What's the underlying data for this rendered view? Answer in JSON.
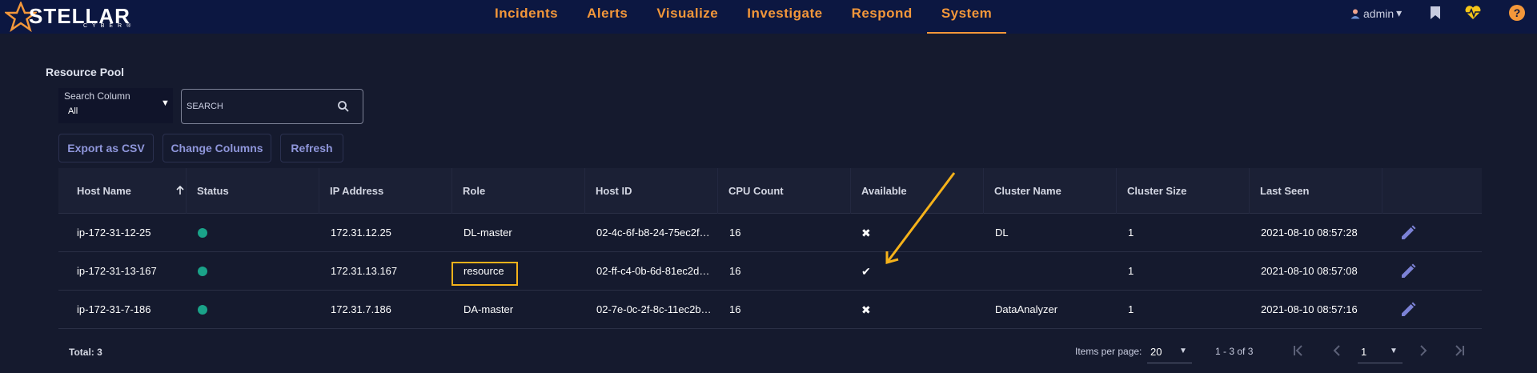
{
  "brand": {
    "name": "STELLAR",
    "sub": "CYBER®"
  },
  "nav": {
    "items": [
      {
        "label": "Incidents"
      },
      {
        "label": "Alerts"
      },
      {
        "label": "Visualize"
      },
      {
        "label": "Investigate"
      },
      {
        "label": "Respond"
      },
      {
        "label": "System",
        "active": true
      }
    ]
  },
  "user": {
    "name": "admin",
    "caret": "▾"
  },
  "icons": {
    "bookmark": "bookmark-icon",
    "health": "heart-pulse-icon",
    "help": "help-icon",
    "help_glyph": "?"
  },
  "page": {
    "title": "Resource Pool"
  },
  "search_column": {
    "label": "Search Column",
    "value": "All",
    "caret": "▼"
  },
  "search": {
    "placeholder": "SEARCH"
  },
  "toolbar": {
    "export_label": "Export as CSV",
    "columns_label": "Change Columns",
    "refresh_label": "Refresh"
  },
  "table": {
    "headers": [
      "Host Name",
      "Status",
      "IP Address",
      "Role",
      "Host ID",
      "CPU Count",
      "Available",
      "Cluster Name",
      "Cluster Size",
      "Last Seen"
    ],
    "rows": [
      {
        "host_name": "ip-172-31-12-25",
        "ip": "172.31.12.25",
        "role": "DL-master",
        "host_id": "02-4c-6f-b8-24-75ec2f…",
        "cpu": "16",
        "available": "✖",
        "cluster_name": "DL",
        "cluster_size": "1",
        "last_seen": "2021-08-10 08:57:28"
      },
      {
        "host_name": "ip-172-31-13-167",
        "ip": "172.31.13.167",
        "role": "resource",
        "host_id": "02-ff-c4-0b-6d-81ec2d…",
        "cpu": "16",
        "available": "✔",
        "cluster_name": "",
        "cluster_size": "1",
        "last_seen": "2021-08-10 08:57:08"
      },
      {
        "host_name": "ip-172-31-7-186",
        "ip": "172.31.7.186",
        "role": "DA-master",
        "host_id": "02-7e-0c-2f-8c-11ec2b…",
        "cpu": "16",
        "available": "✖",
        "cluster_name": "DataAnalyzer",
        "cluster_size": "1",
        "last_seen": "2021-08-10 08:57:16"
      }
    ]
  },
  "footer": {
    "total": "Total: 3",
    "items_per_page_label": "Items per page:",
    "items_per_page": "20",
    "range": "1 - 3 of 3",
    "page": "1",
    "caret": "▼"
  },
  "colors": {
    "nav_bg": "#0c1741",
    "accent": "#f3973a",
    "page_bg": "#151a2e",
    "status_ok": "#1aa389",
    "highlight": "#f5b21a",
    "button_text": "#8f96db"
  }
}
